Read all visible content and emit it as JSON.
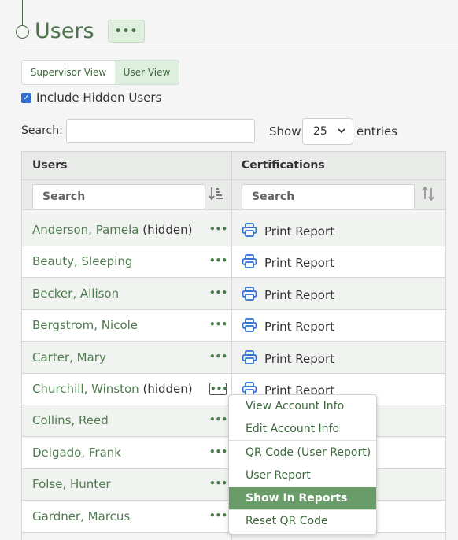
{
  "page": {
    "title": "Users",
    "more_label": "•••"
  },
  "views": {
    "supervisor": "Supervisor View",
    "user": "User View"
  },
  "include_hidden": {
    "label": "Include Hidden Users",
    "checked": true
  },
  "search": {
    "label": "Search:",
    "value": ""
  },
  "length": {
    "show_label": "Show",
    "value": "25",
    "entries_label": "entries"
  },
  "table": {
    "columns": [
      "Users",
      "Certifications"
    ],
    "filter_placeholder": "Search",
    "rows": [
      {
        "name": "Anderson, Pamela",
        "hidden": "(hidden)",
        "action": "Print Report"
      },
      {
        "name": "Beauty, Sleeping",
        "hidden": "",
        "action": "Print Report"
      },
      {
        "name": "Becker, Allison",
        "hidden": "",
        "action": "Print Report"
      },
      {
        "name": "Bergstrom, Nicole",
        "hidden": "",
        "action": "Print Report"
      },
      {
        "name": "Carter, Mary",
        "hidden": "",
        "action": "Print Report"
      },
      {
        "name": "Churchill, Winston",
        "hidden": "(hidden)",
        "action": "Print Report"
      },
      {
        "name": "Collins, Reed",
        "hidden": "",
        "action": ""
      },
      {
        "name": "Delgado, Frank",
        "hidden": "",
        "action": ""
      },
      {
        "name": "Folse, Hunter",
        "hidden": "",
        "action": ""
      },
      {
        "name": "Gardner, Marcus",
        "hidden": "",
        "action": ""
      }
    ]
  },
  "menu": {
    "items": [
      "View Account Info",
      "Edit Account Info",
      "QR Code (User Report)",
      "User Report",
      "Show In Reports",
      "Reset QR Code"
    ],
    "selected": "Show In Reports"
  },
  "colors": {
    "accent": "#4e734e",
    "menu_selected": "#6a9c6a",
    "checkbox": "#2f6fd1",
    "print_icon": "#2f6fd1"
  },
  "icons": {
    "print": "printer-icon",
    "sort_users": "sort-amount-down-icon",
    "sort_certs": "sort-icon",
    "more": "ellipsis-icon"
  }
}
